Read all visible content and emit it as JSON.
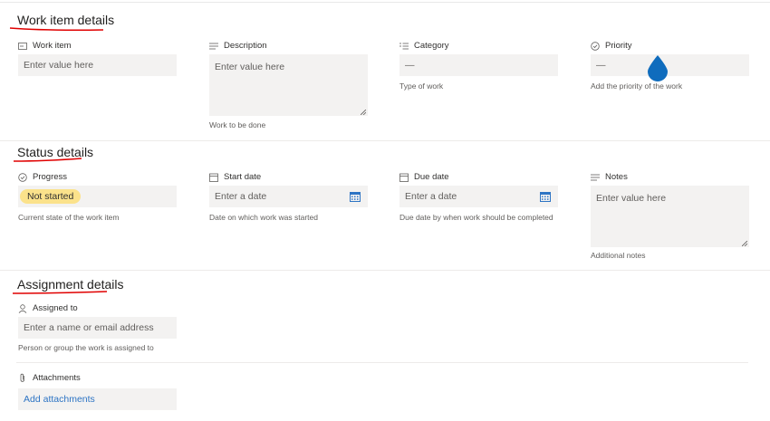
{
  "sections": {
    "work_item": {
      "title": "Work item details",
      "fields": {
        "work_item": {
          "label": "Work item",
          "placeholder": "Enter value here"
        },
        "description": {
          "label": "Description",
          "placeholder": "Enter value here",
          "help": "Work to be done"
        },
        "category": {
          "label": "Category",
          "value": "—",
          "help": "Type of work"
        },
        "priority": {
          "label": "Priority",
          "value": "—",
          "help": "Add the priority of the work"
        }
      }
    },
    "status": {
      "title": "Status details",
      "fields": {
        "progress": {
          "label": "Progress",
          "value": "Not started",
          "help": "Current state of the work item"
        },
        "start_date": {
          "label": "Start date",
          "placeholder": "Enter a date",
          "help": "Date on which work was started"
        },
        "due_date": {
          "label": "Due date",
          "placeholder": "Enter a date",
          "help": "Due date by when work should be completed"
        },
        "notes": {
          "label": "Notes",
          "placeholder": "Enter value here",
          "help": "Additional notes"
        }
      }
    },
    "assignment": {
      "title": "Assignment details",
      "fields": {
        "assigned_to": {
          "label": "Assigned to",
          "placeholder": "Enter a name or email address",
          "help": "Person or group the work is assigned to"
        },
        "attachments": {
          "label": "Attachments",
          "action": "Add attachments"
        }
      }
    }
  },
  "colors": {
    "annotation_underline": "#e00000",
    "progress_pill": "#fbe28b",
    "drop_icon": "#0f6cbd",
    "link": "#2d74c4"
  },
  "icons": [
    "text-field-icon",
    "multiline-text-icon",
    "choice-list-icon",
    "check-circle-icon",
    "calendar-icon",
    "person-icon",
    "paperclip-icon",
    "water-drop-icon"
  ]
}
